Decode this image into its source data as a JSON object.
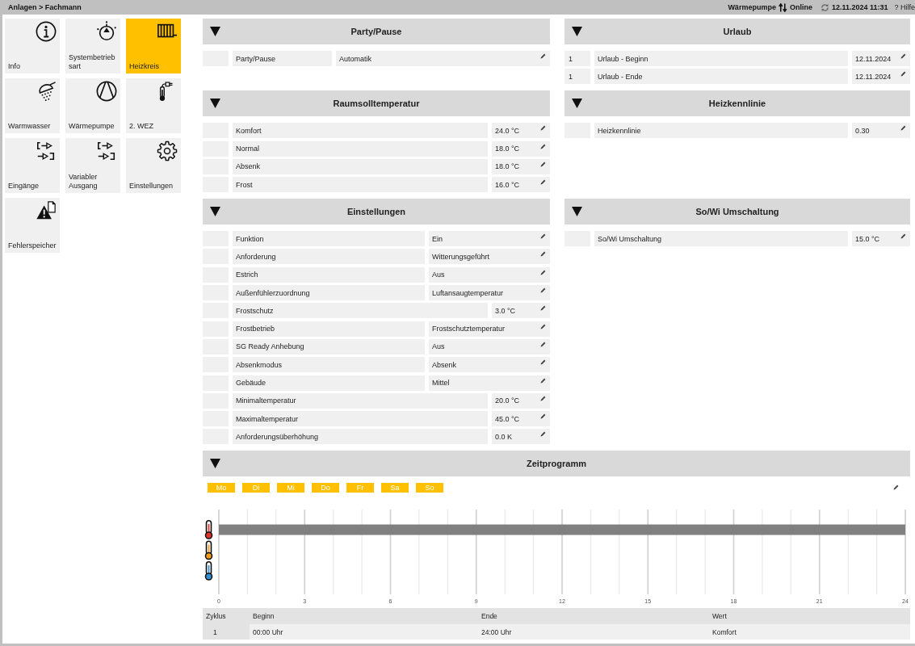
{
  "top_bar": {
    "breadcrumb": "Anlagen > Fachmann",
    "device": "Wärmepumpe",
    "connection": "Online",
    "datetime": "12.11.2024 11:31",
    "help": "? Hilfe"
  },
  "tiles": [
    {
      "label": "Info",
      "selected": false
    },
    {
      "label": "Systembetriebsart",
      "selected": false
    },
    {
      "label": "Heizkreis",
      "selected": true
    },
    {
      "label": "Warmwasser",
      "selected": false
    },
    {
      "label": "Wärmepumpe",
      "selected": false
    },
    {
      "label": "2. WEZ",
      "selected": false
    },
    {
      "label": "Eingänge",
      "selected": false
    },
    {
      "label": "Variabler Ausgang",
      "selected": false
    },
    {
      "label": "Einstellungen",
      "selected": false
    },
    {
      "label": "Fehlerspeicher",
      "selected": false
    }
  ],
  "panels": [
    {
      "title": "Party/Pause",
      "expanded": true,
      "rows": [
        {
          "kind": "mode",
          "label": "Party/Pause",
          "value": "Automatik"
        }
      ]
    },
    {
      "title": "Urlaub",
      "expanded": true,
      "rows": [
        {
          "kind": "value",
          "index": "1",
          "label": "Urlaub - Beginn",
          "value": "12.11.2024"
        },
        {
          "kind": "value",
          "index": "1",
          "label": "Urlaub - Ende",
          "value": "12.11.2024"
        }
      ]
    },
    {
      "title": "Raumsolltemperatur",
      "expanded": true,
      "rows": [
        {
          "kind": "value",
          "label": "Komfort",
          "value": "24.0 °C"
        },
        {
          "kind": "value",
          "label": "Normal",
          "value": "18.0 °C"
        },
        {
          "kind": "value",
          "label": "Absenk",
          "value": "18.0 °C"
        },
        {
          "kind": "value",
          "label": "Frost",
          "value": "16.0 °C"
        }
      ]
    },
    {
      "title": "Heizkennlinie",
      "expanded": true,
      "rows": [
        {
          "kind": "value",
          "label": "Heizkennlinie",
          "value": "0.30"
        }
      ]
    },
    {
      "title": "Einstellungen",
      "expanded": true,
      "rows": [
        {
          "kind": "option",
          "label": "Funktion",
          "value": "Ein"
        },
        {
          "kind": "option",
          "label": "Anforderung",
          "value": "Witterungsgeführt"
        },
        {
          "kind": "option",
          "label": "Estrich",
          "value": "Aus"
        },
        {
          "kind": "option",
          "label": "Außenfühlerzuordnung",
          "value": "Luftansaugtemperatur"
        },
        {
          "kind": "value",
          "label": "Frostschutz",
          "value": "3.0 °C"
        },
        {
          "kind": "option",
          "label": "Frostbetrieb",
          "value": "Frostschutztemperatur"
        },
        {
          "kind": "option",
          "label": "SG Ready Anhebung",
          "value": "Aus"
        },
        {
          "kind": "option",
          "label": "Absenkmodus",
          "value": "Absenk"
        },
        {
          "kind": "option",
          "label": "Gebäude",
          "value": "Mittel"
        },
        {
          "kind": "value",
          "label": "Minimaltemperatur",
          "value": "20.0 °C"
        },
        {
          "kind": "value",
          "label": "Maximaltemperatur",
          "value": "45.0 °C"
        },
        {
          "kind": "value",
          "label": "Anforderungsüberhöhung",
          "value": "0.0 K"
        }
      ]
    },
    {
      "title": "So/Wi Umschaltung",
      "expanded": true,
      "rows": [
        {
          "kind": "value",
          "label": "So/Wi Umschaltung",
          "value": "15.0 °C"
        }
      ]
    }
  ],
  "schedule": {
    "title": "Zeitprogramm",
    "expanded": true,
    "days": [
      {
        "label": "Mo",
        "selected": true
      },
      {
        "label": "Di",
        "selected": true
      },
      {
        "label": "Mi",
        "selected": true
      },
      {
        "label": "Do",
        "selected": true
      },
      {
        "label": "Fr",
        "selected": true
      },
      {
        "label": "Sa",
        "selected": true
      },
      {
        "label": "So",
        "selected": true
      }
    ],
    "chart_data": {
      "type": "bar",
      "orientation": "horizontal",
      "xlim": [
        0,
        24
      ],
      "xticks": [
        0,
        3,
        6,
        9,
        12,
        15,
        18,
        21,
        24
      ],
      "values": [
        24,
        null,
        null
      ],
      "grid": true
    },
    "table": {
      "columns": [
        "Zyklus",
        "Beginn",
        "Ende",
        "Wert"
      ],
      "rows": [
        [
          "1",
          "00:00 Uhr",
          "24:00 Uhr",
          "Komfort"
        ]
      ]
    }
  }
}
